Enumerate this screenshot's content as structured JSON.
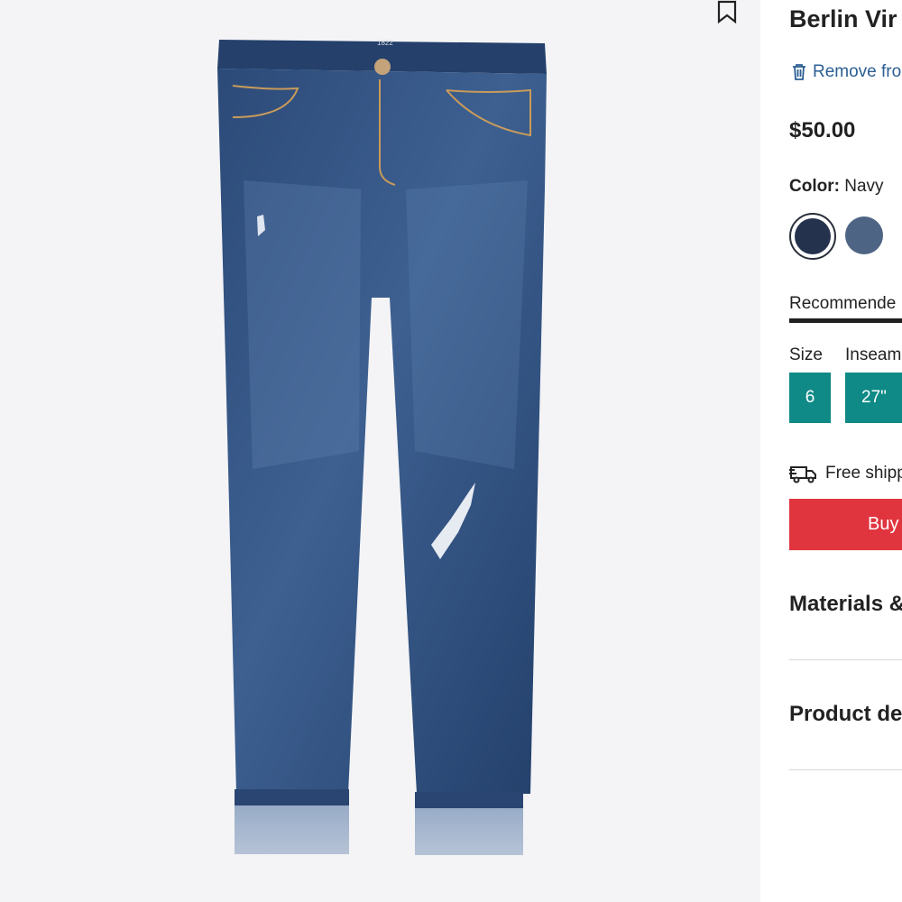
{
  "product": {
    "title": "Berlin Vir",
    "remove_label": "Remove fro",
    "price": "$50.00",
    "color_label": "Color:",
    "color_value": "Navy",
    "swatches": [
      {
        "name": "navy-swatch",
        "hex": "#25324d",
        "selected": true
      },
      {
        "name": "blue-swatch",
        "hex": "#4e6484",
        "selected": false
      }
    ]
  },
  "tabs": {
    "recommended": "Recommende"
  },
  "sizing": {
    "size_label": "Size",
    "inseam_label": "Inseam",
    "size_value": "6",
    "inseam_value": "27\""
  },
  "shipping": {
    "text": "Free shipp",
    "icon": "truck-icon"
  },
  "buy_button": {
    "label": "Buy"
  },
  "accordions": [
    {
      "title": "Materials &"
    },
    {
      "title": "Product det"
    }
  ],
  "colors": {
    "accent_teal": "#0f8a86",
    "buy_red": "#e0343f",
    "link_blue": "#2b5e93",
    "image_bg": "#f4f4f6"
  },
  "image": {
    "brand_label": "1822"
  }
}
